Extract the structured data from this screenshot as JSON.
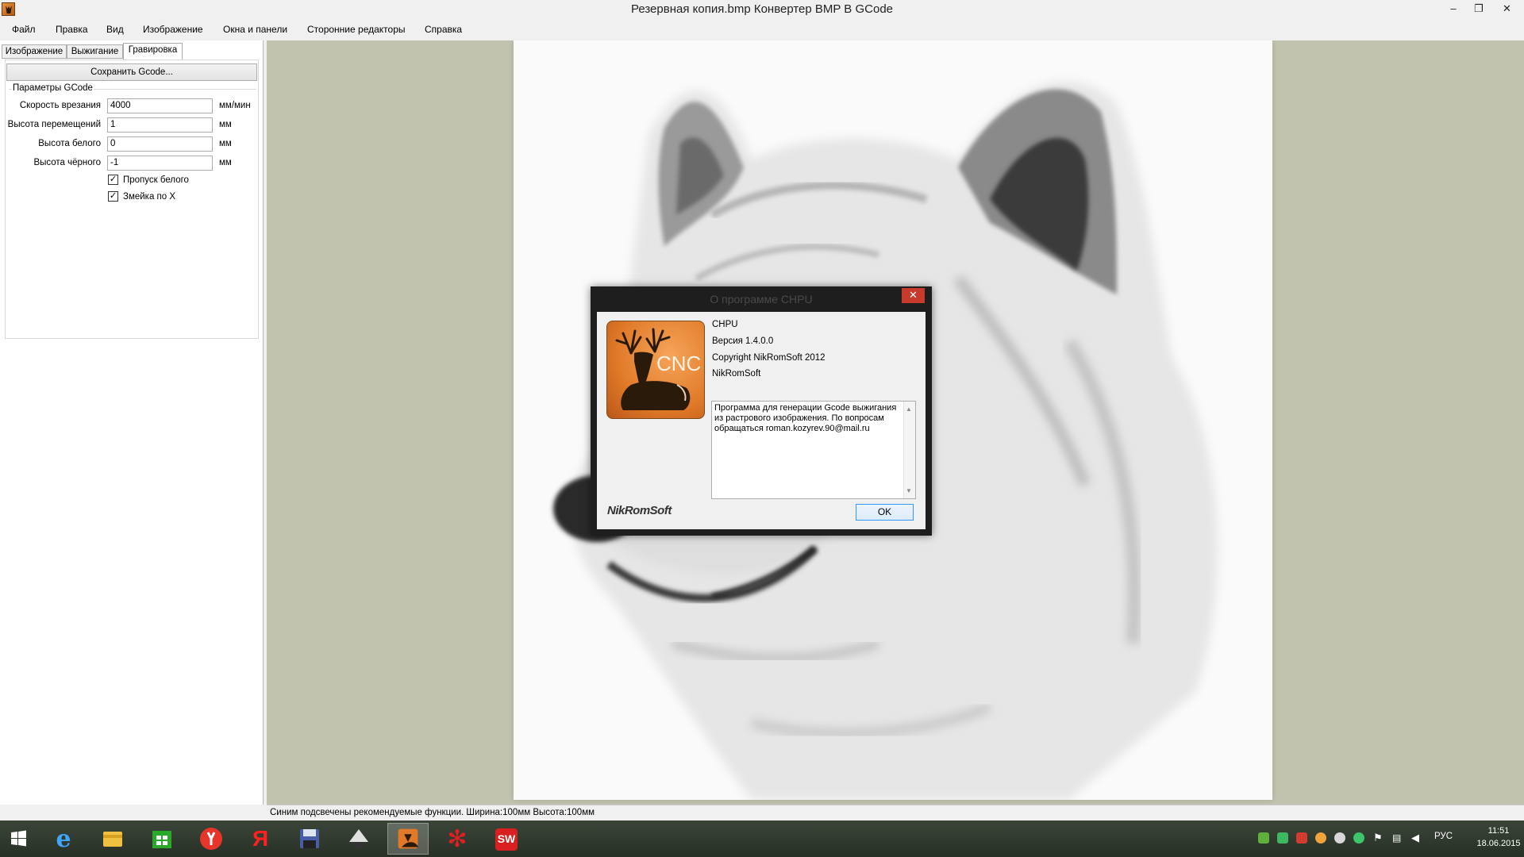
{
  "window": {
    "title": "Резервная копия.bmp Конвертер BMP В GCode",
    "controls": {
      "minimize": "–",
      "restore": "❐",
      "close": "✕"
    }
  },
  "menu": {
    "items": [
      "Файл",
      "Правка",
      "Вид",
      "Изображение",
      "Окна и панели",
      "Сторонние редакторы",
      "Справка"
    ]
  },
  "left_panel": {
    "tabs": [
      "Изображение",
      "Выжигание",
      "Гравировка"
    ],
    "active_tab": "Гравировка",
    "save_button": "Сохранить Gcode...",
    "group_title": "Параметры GCode",
    "fields": [
      {
        "label": "Скорость врезания",
        "value": "4000",
        "unit": "мм/мин"
      },
      {
        "label": "Высота перемещений",
        "value": "1",
        "unit": "мм"
      },
      {
        "label": "Высота белого",
        "value": "0",
        "unit": "мм"
      },
      {
        "label": "Высота чёрного",
        "value": "-1",
        "unit": "мм"
      }
    ],
    "checkboxes": [
      {
        "label": "Пропуск белого",
        "checked": true,
        "mark": "✓"
      },
      {
        "label": "Змейка по X",
        "checked": true,
        "mark": "✓"
      }
    ]
  },
  "canvas": {
    "image_subject": "wolf-sketch",
    "background": "#c1c3ae"
  },
  "status_bar": {
    "text": "Синим подсвечены рекомендуемые функции. Ширина:100мм Высота:100мм"
  },
  "about_dialog": {
    "title": "О программе CHPU",
    "close": "✕",
    "logo_text": "CNC",
    "product": "CHPU",
    "version": "Версия 1.4.0.0",
    "copyright": "Copyright NikRomSoft  2012",
    "company": "NikRomSoft",
    "description": "Программа для генерации Gcode выжигания из растрового изображения. По вопросам обращаться roman.kozyrev.90@mail.ru",
    "brand": "NikRomSoft",
    "ok_button": "OK"
  },
  "taskbar": {
    "apps": [
      "start-icon",
      "internet-explorer-icon",
      "file-explorer-icon",
      "store-icon",
      "yandex-browser-icon",
      "yandex-icon",
      "floppy-save-icon",
      "inkscape-icon",
      "chpu-app-icon",
      "red-snowflake-app-icon",
      "solidworks-2015-icon"
    ],
    "tray_icons": [
      "nvidia-icon",
      "check-shield-icon",
      "speaker-app-icon",
      "orange-app-icon",
      "sync-icon",
      "green-circle-icon",
      "flag-icon",
      "network-icon",
      "volume-icon"
    ],
    "language": "РУС",
    "time": "11:51",
    "date": "18.06.2015"
  }
}
